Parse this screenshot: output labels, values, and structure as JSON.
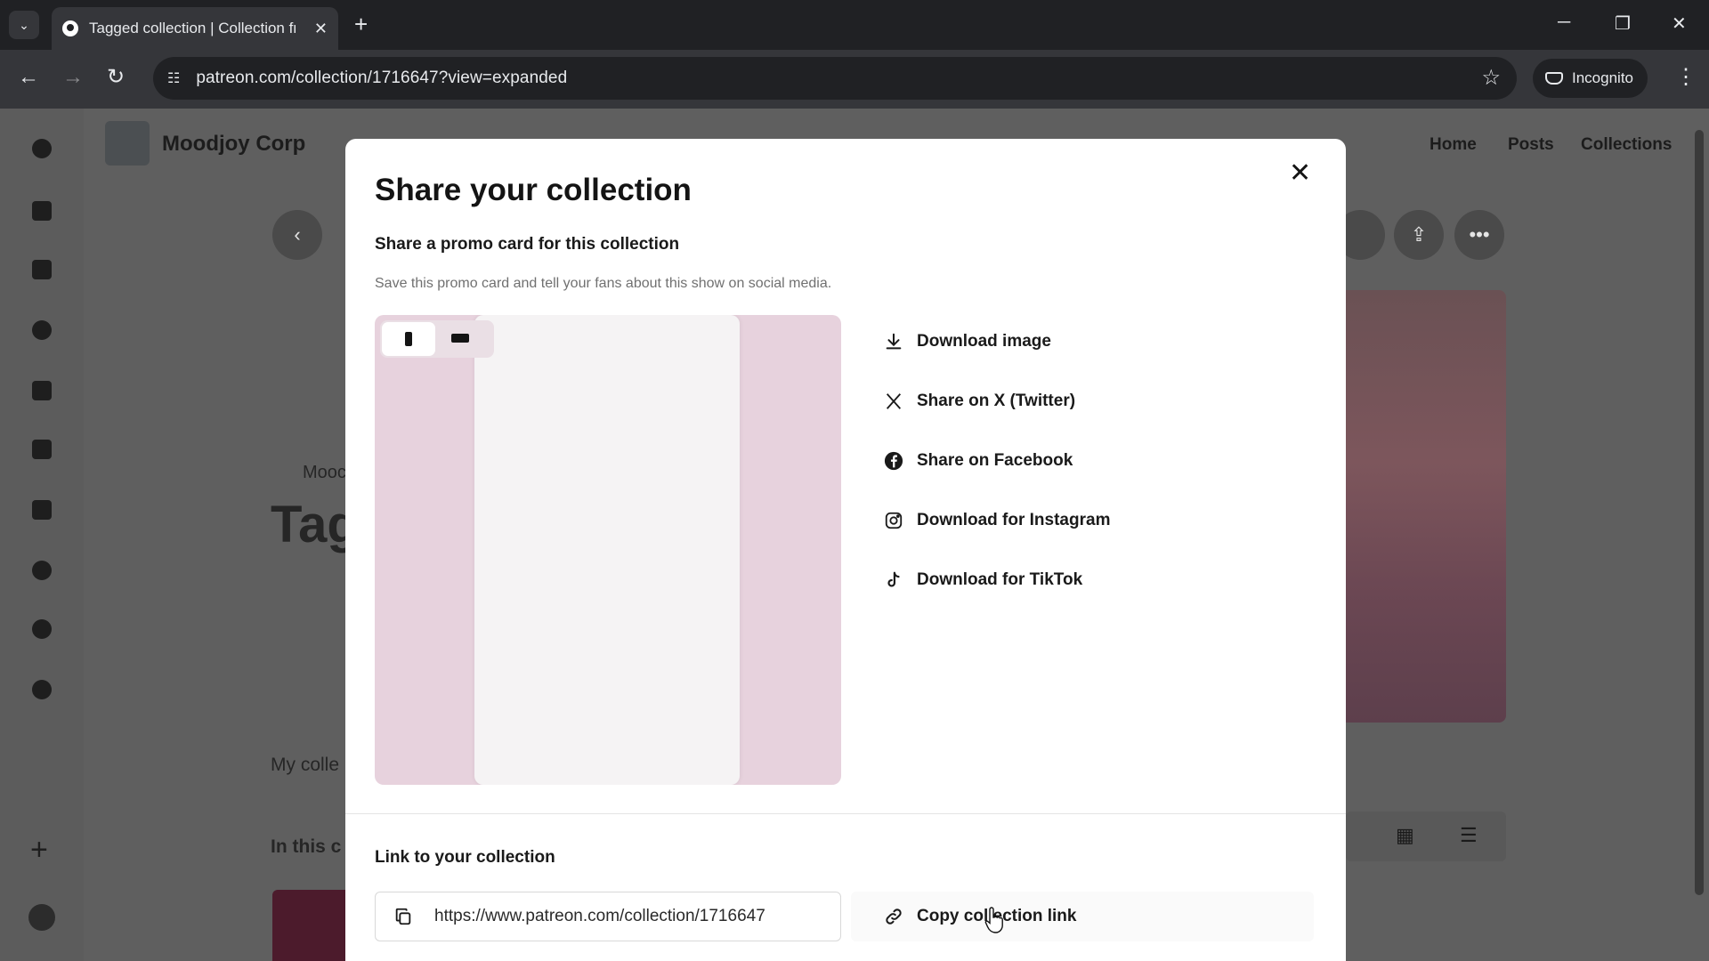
{
  "browser": {
    "tab_title": "Tagged collection | Collection fr",
    "url": "patreon.com/collection/1716647?view=expanded",
    "incognito_label": "Incognito"
  },
  "topnav": {
    "creator_name": "Moodjoy Corp",
    "links": [
      "Home",
      "Posts",
      "Collections"
    ]
  },
  "behind": {
    "creator_short": "Mooc",
    "title_partial": "Tag",
    "description_partial": "My colle",
    "section_partial": "In this c"
  },
  "modal": {
    "title": "Share your collection",
    "promo_heading": "Share a promo card for this collection",
    "promo_description": "Save this promo card and tell your fans about this show on social media.",
    "share_options": [
      {
        "label": "Download image",
        "icon": "download-icon"
      },
      {
        "label": "Share on X (Twitter)",
        "icon": "x-twitter-icon"
      },
      {
        "label": "Share on Facebook",
        "icon": "facebook-icon"
      },
      {
        "label": "Download for Instagram",
        "icon": "instagram-icon"
      },
      {
        "label": "Download for TikTok",
        "icon": "tiktok-icon"
      }
    ],
    "link_heading": "Link to your collection",
    "link_value": "https://www.patreon.com/collection/1716647",
    "copy_label": "Copy collection link"
  },
  "colors": {
    "preview_bg": "#e7d2dd",
    "overlay": "#5f5f5f"
  }
}
